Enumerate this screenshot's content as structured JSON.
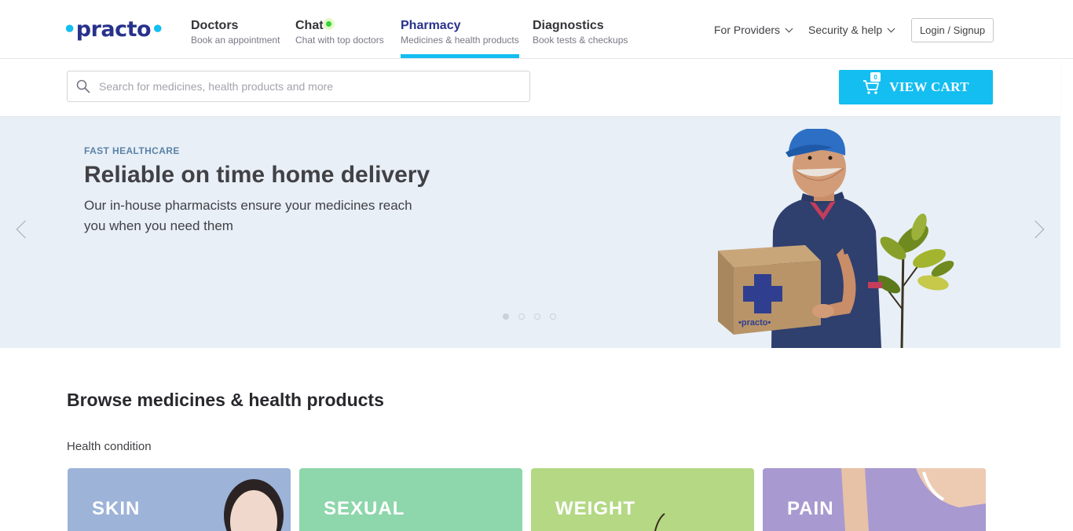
{
  "brand": {
    "logo_text_pre": "•",
    "logo_text_mid": "practo",
    "logo_text_post": "•"
  },
  "nav": [
    {
      "title": "Doctors",
      "subtitle": "Book an appointment"
    },
    {
      "title": "Chat",
      "subtitle": "Chat with top doctors"
    },
    {
      "title": "Pharmacy",
      "subtitle": "Medicines & health products"
    },
    {
      "title": "Diagnostics",
      "subtitle": "Book tests & checkups"
    }
  ],
  "header_right": {
    "providers": "For Providers",
    "security": "Security & help",
    "login": "Login / Signup"
  },
  "search": {
    "placeholder": "Search for medicines, health products and more",
    "value": ""
  },
  "cart": {
    "label": "VIEW CART",
    "count": "0"
  },
  "banner": {
    "eyebrow": "FAST HEALTHCARE",
    "title": "Reliable on time home delivery",
    "subtitle": "Our in-house pharmacists ensure your medicines reach you when you need them",
    "box_text": "•practo•",
    "active_slide": 1,
    "slides": 4
  },
  "browse": {
    "title": "Browse medicines & health products",
    "section_label": "Health condition",
    "categories": [
      {
        "label": "SKIN",
        "color": "#9db3d8"
      },
      {
        "label": "SEXUAL",
        "color": "#8ed6ab"
      },
      {
        "label": "WEIGHT",
        "color": "#b4d884"
      },
      {
        "label": "PAIN",
        "color": "#a89ad0"
      }
    ]
  },
  "colors": {
    "accent": "#14bef0",
    "brand_navy": "#28328c",
    "banner_bg": "#e8eff6"
  }
}
